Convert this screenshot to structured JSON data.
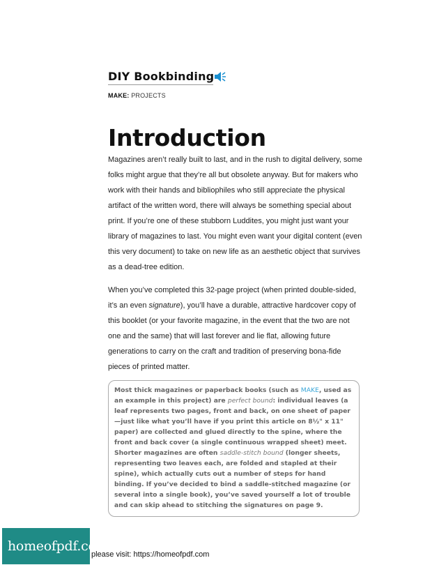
{
  "header": {
    "title": "DIY Bookbinding",
    "audio_icon": "speaker-icon",
    "section_label": "MAKE:",
    "section_value": "PROJECTS"
  },
  "main": {
    "title": "Introduction",
    "p1": "Magazines aren’t really built to last, and in the rush to digital delivery, some folks might argue that they’re all but obsolete anyway. But for makers who work with their hands and bibliophiles who still appreciate the physical artifact of the written word, there will always be something special about print. If you’re one of these stubborn Luddites, you might just want your library of magazines to last. You might even want your digital content (even this very document) to take on new life as an aesthetic object that survives as a dead-tree edition.",
    "p2_a": "When you’ve completed this 32-page project (when printed double-sided, it’s an even ",
    "p2_em": "signature",
    "p2_b": "), you’ll have a durable, attractive hardcover copy of this booklet (or your favorite magazine, in the event that the two are not one and the same) that will last forever and lie flat, allowing future generations to carry on the craft and tradition of preserving bona-fide pieces of printed matter."
  },
  "callout": {
    "t1": "Most thick magazines or paperback books (such as ",
    "link": "MAKE",
    "t2": ", used as an example in this project) are ",
    "em1": "perfect bound",
    "t3": ": individual leaves (a leaf represents two pages, front and back, on one sheet of paper—just like what you’ll have if you print this article on 8½\" x 11\" paper) are collected and glued directly to the spine, where the front and back cover (a single continuous wrapped sheet) meet. Shorter magazines are often ",
    "em2": "saddle-stitch bound",
    "t4": " (longer sheets, representing two leaves each, are folded and stapled at their spine), which actually cuts out a number of steps for hand binding. If you’ve decided to bind a saddle-stitched magazine (or several into a single book), you’ve saved yourself a lot of trouble and can skip ahead to stitching the signatures on page 9."
  },
  "watermark": {
    "logo": "homeofpdf.com",
    "text": "please visit: https://homeofpdf.com"
  }
}
